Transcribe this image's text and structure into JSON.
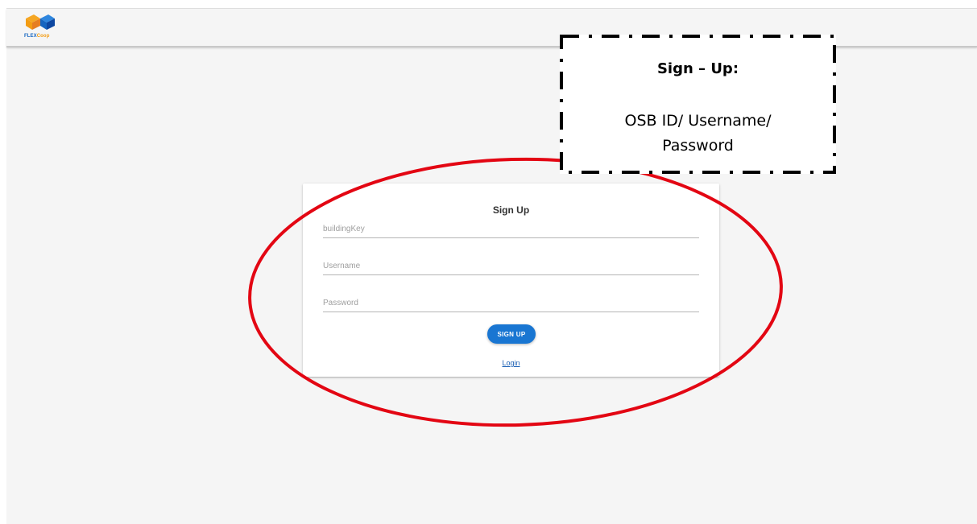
{
  "app": {
    "logo_text_flex": "FLEX",
    "logo_text_coop": "Coop"
  },
  "form": {
    "title": "Sign Up",
    "building_key_placeholder": "buildingKey",
    "username_placeholder": "Username",
    "password_placeholder": "Password",
    "submit_label": "SIGN UP",
    "login_link": "Login"
  },
  "annotation": {
    "title": "Sign – Up:",
    "body_line1": "OSB ID/ Username/",
    "body_line2": "Password"
  },
  "colors": {
    "primary": "#1976d2",
    "highlight": "#e30613",
    "background": "#f5f5f5"
  }
}
